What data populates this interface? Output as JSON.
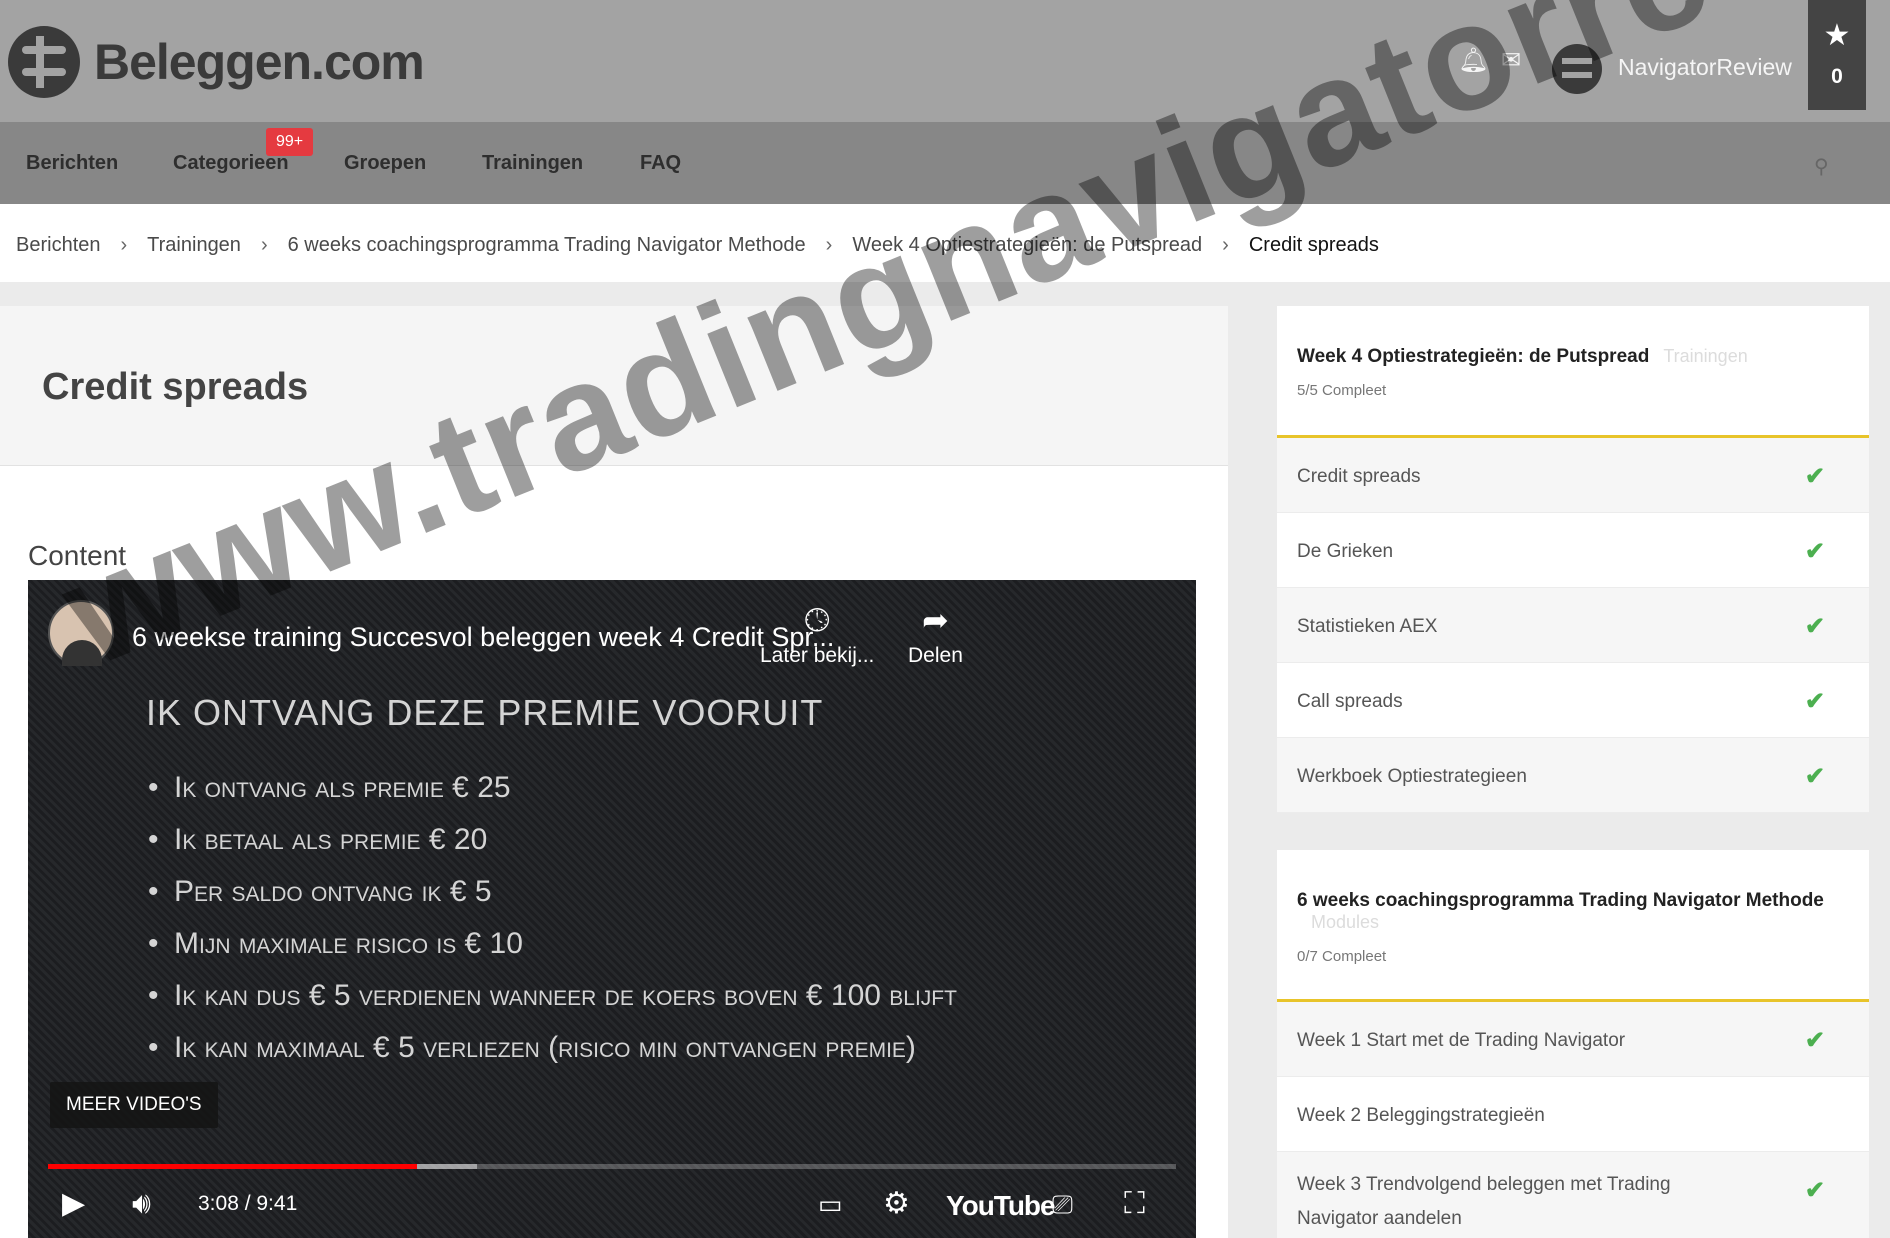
{
  "header": {
    "logo_text": "Beleggen.com",
    "icons": [
      "bell-icon",
      "inbox-icon"
    ],
    "username": "NavigatorReview",
    "favorites_count": "0"
  },
  "nav": {
    "items": [
      "Berichten",
      "Categorieen",
      "Groepen",
      "Trainingen",
      "FAQ"
    ],
    "badge": "99+"
  },
  "breadcrumb": {
    "items": [
      "Berichten",
      "Trainingen",
      "6 weeks coachingsprogramma Trading Navigator Methode",
      "Week 4 Optiestrategieën: de Putspread"
    ],
    "current": "Credit spreads",
    "separator": "›"
  },
  "main": {
    "title": "Credit spreads",
    "section_label": "Content"
  },
  "video": {
    "title": "6 weekse training Succesvol beleggen week 4 Credit Spr...",
    "watch_later": "Later bekij...",
    "share": "Delen",
    "slide_heading": "IK ONTVANG DEZE PREMIE VOORUIT",
    "bullets": [
      "Ik ontvang als premie € 25",
      "Ik betaal als premie € 20",
      "Per saldo ontvang ik € 5",
      "Mijn maximale risico is € 10",
      "Ik kan dus € 5 verdienen wanneer de koers boven € 100 blijft",
      "Ik kan maximaal € 5 verliezen (risico min ontvangen premie)"
    ],
    "more_videos": "MEER VIDEO'S",
    "time": "3:08 / 9:41",
    "played_fraction": 0.327,
    "buffered_fraction": 0.38,
    "brand": "YouTube"
  },
  "sidebar": {
    "week_panel": {
      "title": "Week 4 Optiestrategieën: de Putspread",
      "tag": "Trainingen",
      "progress": "5/5 Compleet",
      "lessons": [
        {
          "label": "Credit spreads",
          "done": true
        },
        {
          "label": "De Grieken",
          "done": true
        },
        {
          "label": "Statistieken AEX",
          "done": true
        },
        {
          "label": "Call spreads",
          "done": true
        },
        {
          "label": "Werkboek Optiestrategieen",
          "done": true
        }
      ]
    },
    "course_panel": {
      "title": "6 weeks coachingsprogramma Trading Navigator Methode",
      "tag": "Modules",
      "progress": "0/7 Compleet",
      "lessons": [
        {
          "label": "Week 1 Start met de Trading Navigator",
          "done": true
        },
        {
          "label": "Week 2 Beleggingstrategieën",
          "done": false
        },
        {
          "label": "Week 3 Trendvolgend beleggen met Trading Navigator aandelen",
          "done": true
        }
      ]
    },
    "check_glyph": "✔"
  },
  "watermark": "www.tradingnavigatorreview.nl"
}
